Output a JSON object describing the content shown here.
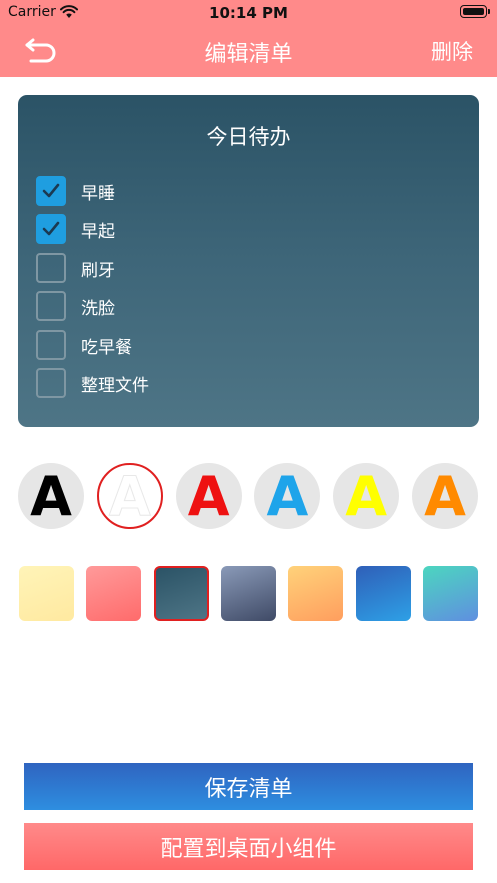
{
  "status_bar": {
    "carrier": "Carrier",
    "time": "10:14 PM"
  },
  "nav": {
    "title": "编辑清单",
    "delete_label": "删除"
  },
  "card": {
    "title": "今日待办",
    "items": [
      {
        "label": "早睡",
        "checked": true
      },
      {
        "label": "早起",
        "checked": true
      },
      {
        "label": "刷牙",
        "checked": false
      },
      {
        "label": "洗脸",
        "checked": false
      },
      {
        "label": "吃早餐",
        "checked": false
      },
      {
        "label": "整理文件",
        "checked": false
      }
    ]
  },
  "font_colors": {
    "glyph": "A",
    "options": [
      {
        "color": "#000000",
        "selected": false
      },
      {
        "color": "#ffffff",
        "selected": true
      },
      {
        "color": "#ee1111",
        "selected": false
      },
      {
        "color": "#1ea4ea",
        "selected": false
      },
      {
        "color": "#ffff00",
        "selected": false
      },
      {
        "color": "#ff8a00",
        "selected": false
      }
    ]
  },
  "backgrounds": [
    {
      "from": "#fff4b8",
      "to": "#ffe9a0",
      "selected": false
    },
    {
      "from": "#ff9a9a",
      "to": "#ff6b6b",
      "selected": false
    },
    {
      "from": "#2b5366",
      "to": "#4e7586",
      "selected": true
    },
    {
      "from": "#8a9ab8",
      "to": "#3f4a66",
      "selected": false
    },
    {
      "from": "#ffd27a",
      "to": "#ff9e5e",
      "selected": false
    },
    {
      "from": "#2f5fb8",
      "to": "#2ea0e6",
      "selected": false
    },
    {
      "from": "#4cd6bf",
      "to": "#5f8fe0",
      "selected": false
    }
  ],
  "buttons": {
    "save_label": "保存清单",
    "config_label": "配置到桌面小组件"
  }
}
